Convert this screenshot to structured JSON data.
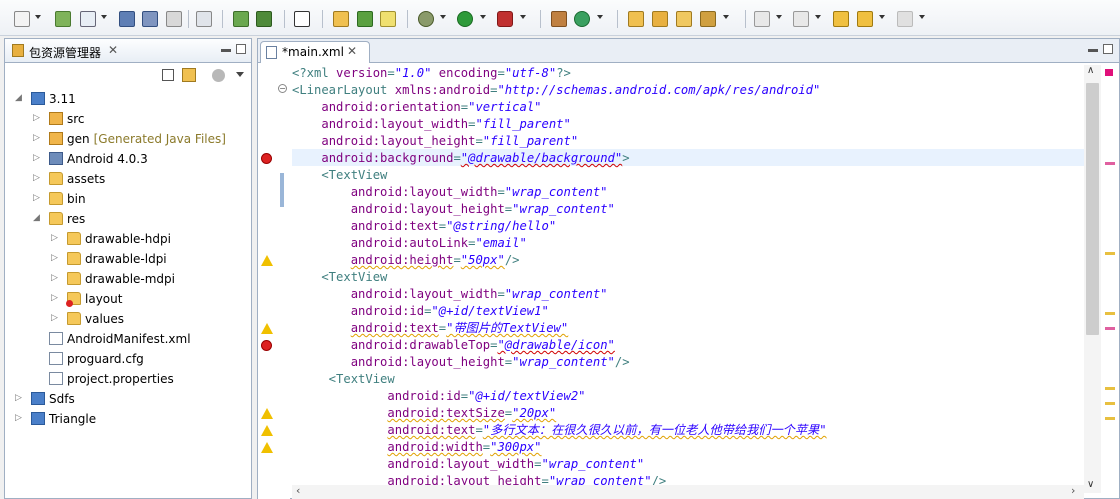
{
  "left_panel": {
    "title": "包资源管理器",
    "tree": [
      {
        "label": "3.11",
        "sub": "",
        "depth": 0,
        "expanded": true,
        "icon": "project-icon"
      },
      {
        "label": "src",
        "sub": "",
        "depth": 1,
        "expanded": false,
        "icon": "package-folder-icon"
      },
      {
        "label": "gen",
        "sub": "[Generated Java Files]",
        "depth": 1,
        "expanded": false,
        "icon": "package-folder-icon"
      },
      {
        "label": "Android 4.0.3",
        "sub": "",
        "depth": 1,
        "expanded": false,
        "icon": "library-icon"
      },
      {
        "label": "assets",
        "sub": "",
        "depth": 1,
        "expanded": false,
        "icon": "folder-icon"
      },
      {
        "label": "bin",
        "sub": "",
        "depth": 1,
        "expanded": false,
        "icon": "folder-icon"
      },
      {
        "label": "res",
        "sub": "",
        "depth": 1,
        "expanded": true,
        "icon": "folder-icon"
      },
      {
        "label": "drawable-hdpi",
        "sub": "",
        "depth": 2,
        "expanded": false,
        "icon": "folder-icon"
      },
      {
        "label": "drawable-ldpi",
        "sub": "",
        "depth": 2,
        "expanded": false,
        "icon": "folder-icon"
      },
      {
        "label": "drawable-mdpi",
        "sub": "",
        "depth": 2,
        "expanded": false,
        "icon": "folder-icon"
      },
      {
        "label": "layout",
        "sub": "",
        "depth": 2,
        "expanded": false,
        "icon": "folder-error-icon"
      },
      {
        "label": "values",
        "sub": "",
        "depth": 2,
        "expanded": false,
        "icon": "folder-icon"
      },
      {
        "label": "AndroidManifest.xml",
        "sub": "",
        "depth": 1,
        "expanded": null,
        "icon": "xml-file-icon"
      },
      {
        "label": "proguard.cfg",
        "sub": "",
        "depth": 1,
        "expanded": null,
        "icon": "file-icon"
      },
      {
        "label": "project.properties",
        "sub": "",
        "depth": 1,
        "expanded": null,
        "icon": "file-icon"
      },
      {
        "label": "Sdfs",
        "sub": "",
        "depth": 0,
        "expanded": false,
        "icon": "project-icon"
      },
      {
        "label": "Triangle",
        "sub": "",
        "depth": 0,
        "expanded": false,
        "icon": "project-icon"
      }
    ]
  },
  "editor": {
    "tab_label": "*main.xml",
    "lines": [
      [
        [
          "pi",
          "<?xml "
        ],
        [
          "attr",
          "version"
        ],
        [
          "tag",
          "="
        ],
        [
          "val",
          "\"1.0\""
        ],
        [
          "attr",
          " encoding"
        ],
        [
          "tag",
          "="
        ],
        [
          "val",
          "\"utf-8\""
        ],
        [
          "pi",
          "?>"
        ]
      ],
      [
        [
          "tag",
          "<LinearLayout "
        ],
        [
          "attr",
          "xmlns:android"
        ],
        [
          "tag",
          "="
        ],
        [
          "val",
          "\"http://schemas.android.com/apk/res/android\""
        ]
      ],
      [
        [
          "tag",
          "    "
        ],
        [
          "attr",
          "android:orientation"
        ],
        [
          "tag",
          "="
        ],
        [
          "val",
          "\"vertical\""
        ]
      ],
      [
        [
          "tag",
          "    "
        ],
        [
          "attr",
          "android:layout_width"
        ],
        [
          "tag",
          "="
        ],
        [
          "val",
          "\"fill_parent\""
        ]
      ],
      [
        [
          "tag",
          "    "
        ],
        [
          "attr",
          "android:layout_height"
        ],
        [
          "tag",
          "="
        ],
        [
          "val",
          "\"fill_parent\""
        ]
      ],
      [
        [
          "tag",
          "    "
        ],
        [
          "attr",
          "android:background"
        ],
        [
          "tag",
          "="
        ],
        [
          "valerr",
          "\"@drawable/background\""
        ],
        [
          "tag",
          ">"
        ]
      ],
      [
        [
          "tag",
          "    <TextView"
        ]
      ],
      [
        [
          "tag",
          "        "
        ],
        [
          "attr",
          "android:layout_width"
        ],
        [
          "tag",
          "="
        ],
        [
          "val",
          "\"wrap_content\""
        ]
      ],
      [
        [
          "tag",
          "        "
        ],
        [
          "attr",
          "android:layout_height"
        ],
        [
          "tag",
          "="
        ],
        [
          "val",
          "\"wrap_content\""
        ]
      ],
      [
        [
          "tag",
          "        "
        ],
        [
          "attr",
          "android:text"
        ],
        [
          "tag",
          "="
        ],
        [
          "val",
          "\"@string/hello\""
        ]
      ],
      [
        [
          "tag",
          "        "
        ],
        [
          "attr",
          "android:autoLink"
        ],
        [
          "tag",
          "="
        ],
        [
          "val",
          "\"email\""
        ]
      ],
      [
        [
          "tag",
          "        "
        ],
        [
          "attrw",
          "android:height"
        ],
        [
          "tag",
          "="
        ],
        [
          "valw",
          "\"50px\""
        ],
        [
          "tag",
          "/>"
        ]
      ],
      [
        [
          "tag",
          "    <TextView"
        ]
      ],
      [
        [
          "tag",
          "        "
        ],
        [
          "attr",
          "android:layout_width"
        ],
        [
          "tag",
          "="
        ],
        [
          "val",
          "\"wrap_content\""
        ]
      ],
      [
        [
          "tag",
          "        "
        ],
        [
          "attr",
          "android:id"
        ],
        [
          "tag",
          "="
        ],
        [
          "val",
          "\"@+id/textView1\""
        ]
      ],
      [
        [
          "tag",
          "        "
        ],
        [
          "attrw",
          "android:text"
        ],
        [
          "tag",
          "="
        ],
        [
          "valw",
          "\"带图片的TextView\""
        ]
      ],
      [
        [
          "tag",
          "        "
        ],
        [
          "attr",
          "android:drawableTop"
        ],
        [
          "tag",
          "="
        ],
        [
          "valerr",
          "\"@drawable/icon\""
        ]
      ],
      [
        [
          "tag",
          "        "
        ],
        [
          "attr",
          "android:layout_height"
        ],
        [
          "tag",
          "="
        ],
        [
          "val",
          "\"wrap_content\""
        ],
        [
          "tag",
          "/>"
        ]
      ],
      [
        [
          "tag",
          "     <TextView"
        ]
      ],
      [
        [
          "tag",
          "             "
        ],
        [
          "attr",
          "android:id"
        ],
        [
          "tag",
          "="
        ],
        [
          "val",
          "\"@+id/textView2\""
        ]
      ],
      [
        [
          "tag",
          "             "
        ],
        [
          "attrw",
          "android:textSize"
        ],
        [
          "tag",
          "="
        ],
        [
          "valw",
          "\"20px\""
        ]
      ],
      [
        [
          "tag",
          "             "
        ],
        [
          "attrw",
          "android:text"
        ],
        [
          "tag",
          "="
        ],
        [
          "valw",
          "\"多行文本：在很久很久以前，有一位老人他带给我们一个苹果\""
        ]
      ],
      [
        [
          "tag",
          "             "
        ],
        [
          "attrw",
          "android:width"
        ],
        [
          "tag",
          "="
        ],
        [
          "valw",
          "\"300px\""
        ]
      ],
      [
        [
          "tag",
          "             "
        ],
        [
          "attr",
          "android:layout_width"
        ],
        [
          "tag",
          "="
        ],
        [
          "val",
          "\"wrap_content\""
        ]
      ],
      [
        [
          "tag",
          "             "
        ],
        [
          "attr",
          "android:layout_height"
        ],
        [
          "tag",
          "="
        ],
        [
          "val",
          "\"wrap_content\""
        ],
        [
          "tag",
          "/>"
        ]
      ]
    ],
    "markers": [
      {
        "line": 5,
        "type": "error"
      },
      {
        "line": 11,
        "type": "warning"
      },
      {
        "line": 15,
        "type": "warning"
      },
      {
        "line": 16,
        "type": "error"
      },
      {
        "line": 20,
        "type": "warning"
      },
      {
        "line": 21,
        "type": "warning"
      },
      {
        "line": 22,
        "type": "warning"
      }
    ]
  },
  "colors": {
    "tag": "#3f7f7f",
    "attr": "#7f007f",
    "value": "#2a00ff",
    "current_line": "#e8f2fe",
    "error": "#d22222",
    "warning": "#f0c000"
  }
}
